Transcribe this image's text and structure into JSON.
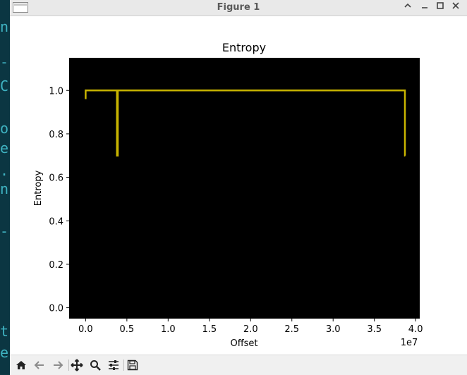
{
  "terminal": {
    "chars": [
      "n",
      "-",
      "C",
      "o",
      "e",
      ".",
      "n",
      "-",
      "t",
      "e"
    ]
  },
  "window": {
    "title": "Figure 1",
    "controls": [
      "collapse-icon",
      "minimize-icon",
      "maximize-icon",
      "close-icon"
    ]
  },
  "toolbar": {
    "buttons": [
      "home-icon",
      "back-icon",
      "forward-icon",
      "pan-icon",
      "zoom-icon",
      "configure-subplots-icon",
      "save-icon"
    ]
  },
  "chart_data": {
    "type": "line",
    "title": "Entropy",
    "xlabel": "Offset",
    "ylabel": "Entropy",
    "x_offset_label": "1e7",
    "xlim": [
      -0.2,
      4.05
    ],
    "ylim": [
      -0.05,
      1.15
    ],
    "x_ticks": [
      0.0,
      0.5,
      1.0,
      1.5,
      2.0,
      2.5,
      3.0,
      3.5,
      4.0
    ],
    "x_tick_labels": [
      "0.0",
      "0.5",
      "1.0",
      "1.5",
      "2.0",
      "2.5",
      "3.0",
      "3.5",
      "4.0"
    ],
    "y_ticks": [
      0.0,
      0.2,
      0.4,
      0.6,
      0.8,
      1.0
    ],
    "y_tick_labels": [
      "0.0",
      "0.2",
      "0.4",
      "0.6",
      "0.8",
      "1.0"
    ],
    "background": "#000000",
    "line_color": "#c8b400",
    "grid": false,
    "series": [
      {
        "x": [
          0.0,
          0.0,
          0.05,
          0.38,
          0.38,
          0.39,
          0.39,
          0.5,
          3.87,
          3.87,
          3.875
        ],
        "y": [
          0.96,
          1.0,
          1.0,
          1.0,
          0.7,
          0.7,
          1.0,
          1.0,
          1.0,
          0.7,
          0.7
        ]
      }
    ]
  }
}
